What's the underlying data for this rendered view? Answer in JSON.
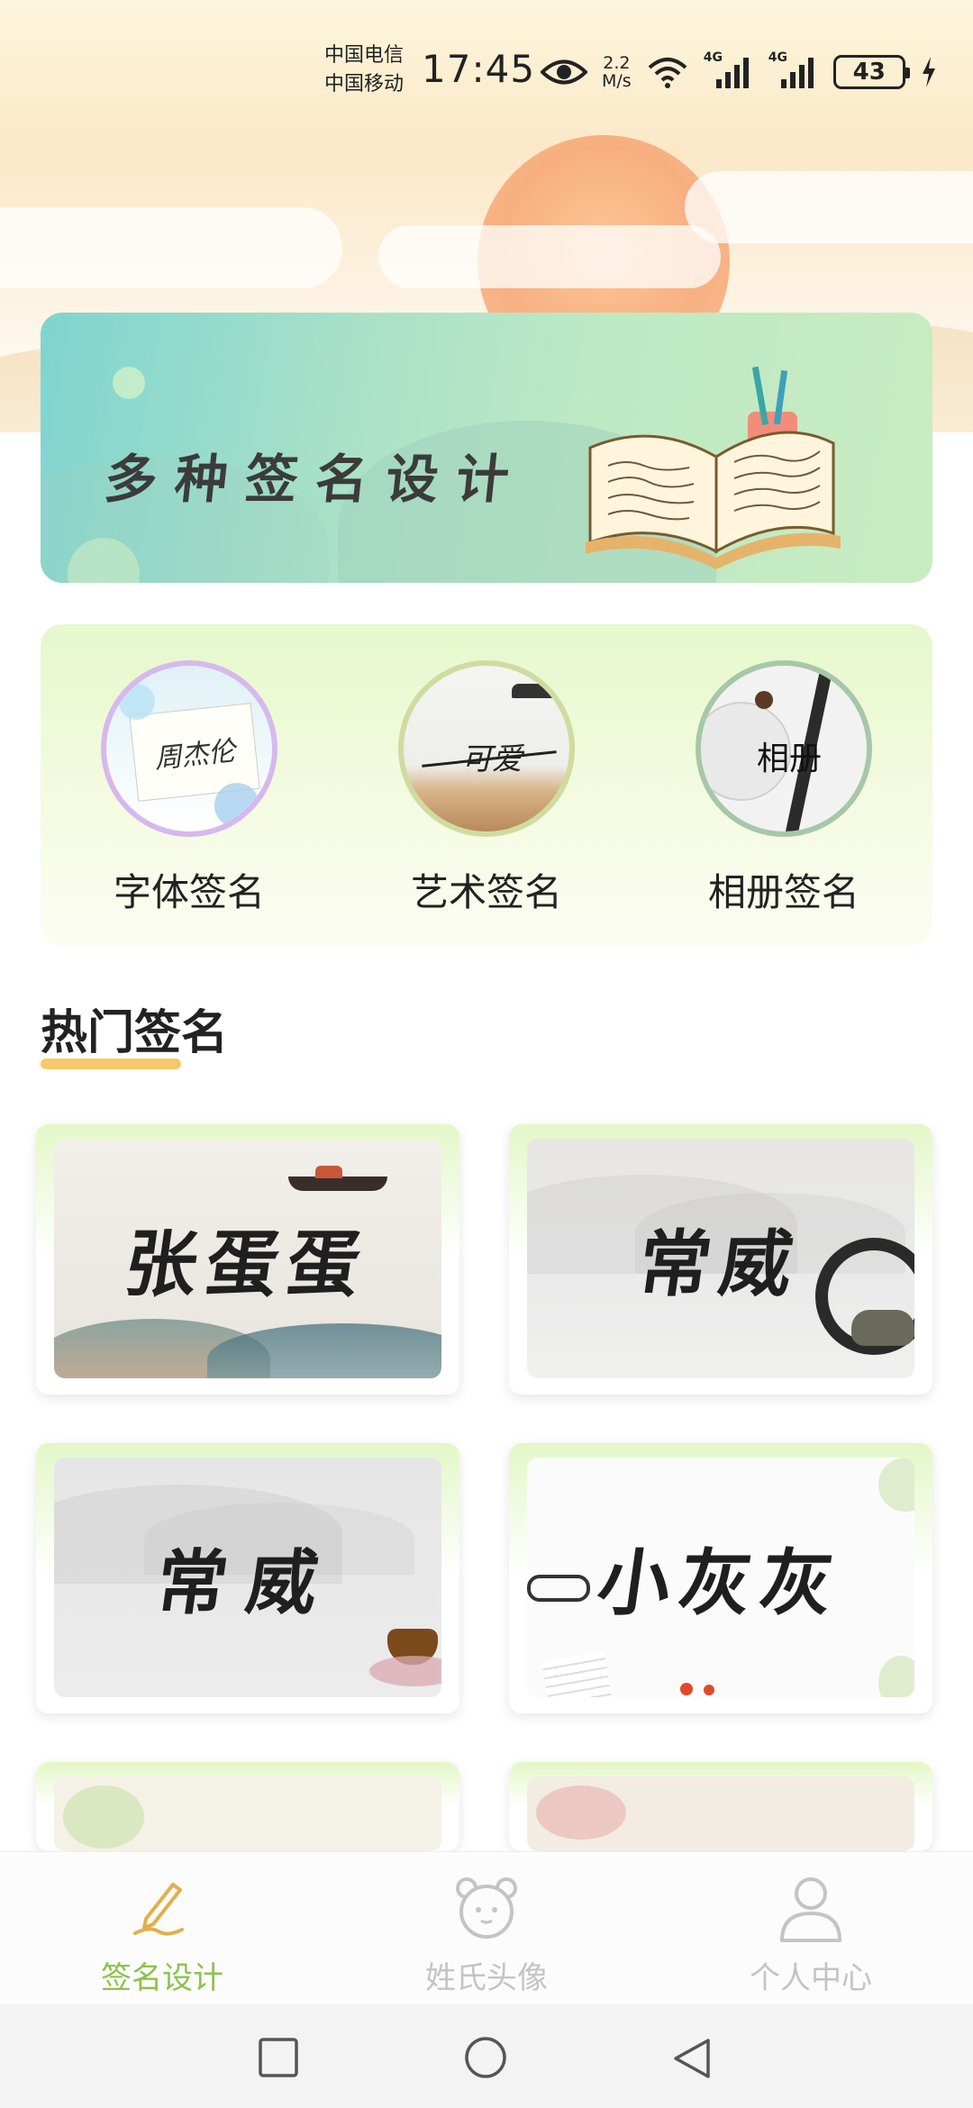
{
  "status_bar": {
    "carrier_1": "中国电信",
    "carrier_2": "中国移动",
    "time": "17:45",
    "net_speed_value": "2.2",
    "net_speed_unit": "M/s",
    "signal_1": "4G",
    "signal_2": "4G",
    "battery": "43"
  },
  "banner": {
    "title": "多种签名设计"
  },
  "categories": [
    {
      "label": "字体签名",
      "preview_text": "周杰伦",
      "icon": "font-signature-icon"
    },
    {
      "label": "艺术签名",
      "preview_text": "可爱",
      "icon": "art-signature-icon"
    },
    {
      "label": "相册签名",
      "preview_text": "相册",
      "icon": "album-signature-icon"
    }
  ],
  "hot_section": {
    "title": "热门签名"
  },
  "signatures": [
    {
      "name": "张蛋蛋"
    },
    {
      "name": "常威"
    },
    {
      "name": "常威"
    },
    {
      "name": "小灰灰"
    }
  ],
  "bottom_nav": [
    {
      "label": "签名设计",
      "icon": "pen-icon",
      "active": true
    },
    {
      "label": "姓氏头像",
      "icon": "bear-icon",
      "active": false
    },
    {
      "label": "个人中心",
      "icon": "person-icon",
      "active": false
    }
  ],
  "colors": {
    "accent_active": "#8bc34a",
    "inactive": "#c4c4c4",
    "underline": "#f6c96a"
  }
}
